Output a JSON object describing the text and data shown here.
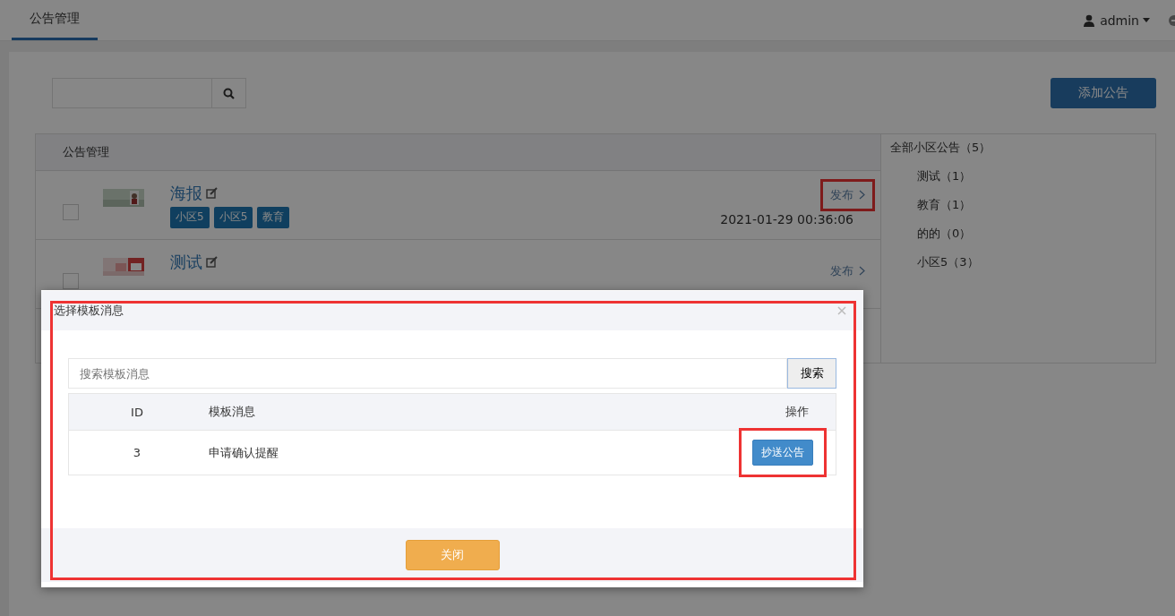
{
  "topbar": {
    "tabs": [
      {
        "label": "公告管理",
        "selected": true
      }
    ],
    "user": "admin"
  },
  "toolbar": {
    "add_button": "添加公告"
  },
  "list": {
    "header": "公告管理",
    "rows": [
      {
        "title": "海报",
        "thumbnail": {
          "kind": "picture"
        },
        "checked": false,
        "tags": [
          "小区5",
          "小区5",
          "教育"
        ],
        "action": "发布",
        "action_highlighted": true,
        "date": "2021-01-29 00:36:06"
      },
      {
        "title": "测试",
        "thumbnail": {
          "kind": "picture"
        },
        "checked": false,
        "tags": [],
        "action": "发布",
        "action_highlighted": false
      }
    ]
  },
  "categories": {
    "all": "全部小区公告（5）",
    "items": [
      {
        "label": "测试（1）"
      },
      {
        "label": "教育（1）"
      },
      {
        "label": "的的（0）"
      },
      {
        "label": "小区5（3）"
      }
    ]
  },
  "modal": {
    "title": "选择模板消息",
    "highlighted": true,
    "search": {
      "placeholder": "搜索模板消息",
      "button": "搜索"
    },
    "columns": [
      "ID",
      "模板消息",
      "操作"
    ],
    "rows": [
      {
        "id": "3",
        "message": "申请确认提醒",
        "action": "抄送公告",
        "action_highlighted": true
      }
    ],
    "close_button": "关闭"
  }
}
